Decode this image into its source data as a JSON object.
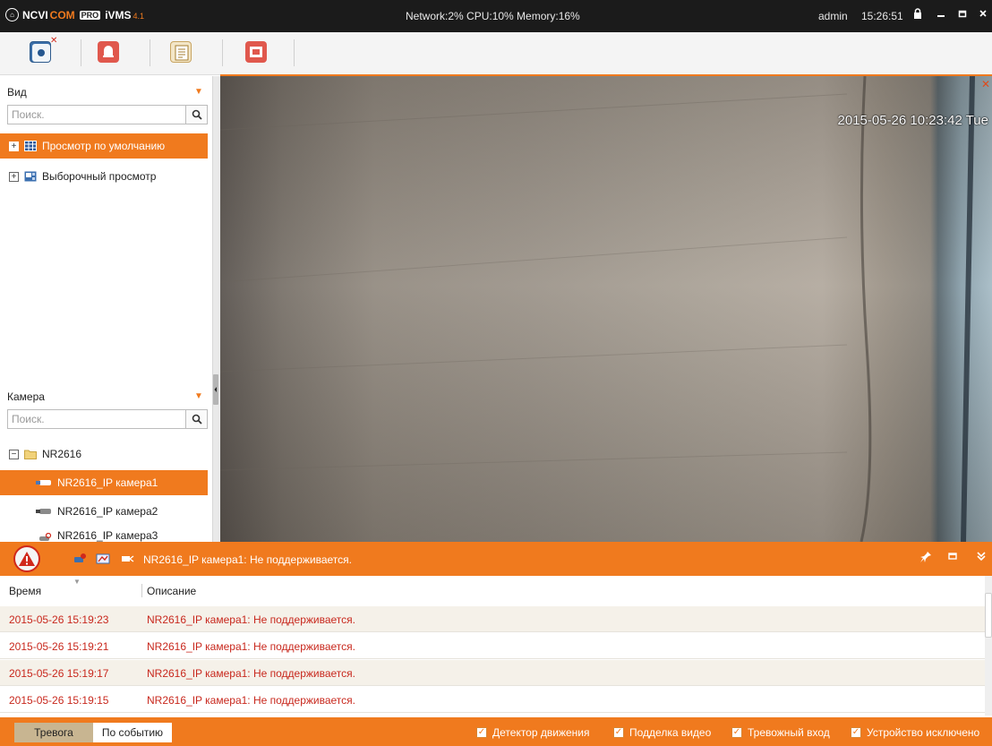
{
  "titlebar": {
    "logo": {
      "brand_left": "NCVI",
      "brand_right": "COM",
      "badge": "PRO",
      "product": "iVMS",
      "version": "4.1"
    },
    "system_stats": "Network:2% CPU:10% Memory:16%",
    "user": "admin",
    "time": "15:26:51"
  },
  "toolbar": {
    "buttons": [
      "main-view-icon",
      "alarm-event-icon",
      "log-icon",
      "file-manager-icon"
    ]
  },
  "view_panel": {
    "header": "Вид",
    "search_placeholder": "Поиск.",
    "items": [
      {
        "label": "Просмотр по умолчанию",
        "selected": true
      },
      {
        "label": "Выборочный просмотр",
        "selected": false
      }
    ]
  },
  "camera_panel": {
    "header": "Камера",
    "search_placeholder": "Поиск.",
    "group": "NR2616",
    "cameras": [
      {
        "label": "NR2616_IP камера1",
        "selected": true
      },
      {
        "label": "NR2616_IP камера2",
        "selected": false
      },
      {
        "label": "NR2616_IP камера3",
        "selected": false
      }
    ]
  },
  "video": {
    "osd_timestamp": "2015-05-26 10:23:42 Tue"
  },
  "alarm_bar": {
    "message": "NR2616_IP камера1: Не поддерживается."
  },
  "events": {
    "columns": {
      "time": "Время",
      "description": "Описание"
    },
    "rows": [
      {
        "time": "2015-05-26 15:19:23",
        "description": "NR2616_IP камера1: Не поддерживается."
      },
      {
        "time": "2015-05-26 15:19:21",
        "description": "NR2616_IP камера1: Не поддерживается."
      },
      {
        "time": "2015-05-26 15:19:17",
        "description": "NR2616_IP камера1: Не поддерживается."
      },
      {
        "time": "2015-05-26 15:19:15",
        "description": "NR2616_IP камера1: Не поддерживается."
      }
    ]
  },
  "status_bar": {
    "tabs": {
      "alarm": "Тревога",
      "event": "По событию"
    },
    "filters": [
      {
        "label": "Детектор движения",
        "checked": true
      },
      {
        "label": "Подделка видео",
        "checked": true
      },
      {
        "label": "Тревожный вход",
        "checked": true
      },
      {
        "label": "Устройство исключено",
        "checked": true
      }
    ]
  },
  "colors": {
    "accent": "#f07a1e",
    "titlebar": "#1b1b1b",
    "event_text": "#c8281d"
  }
}
